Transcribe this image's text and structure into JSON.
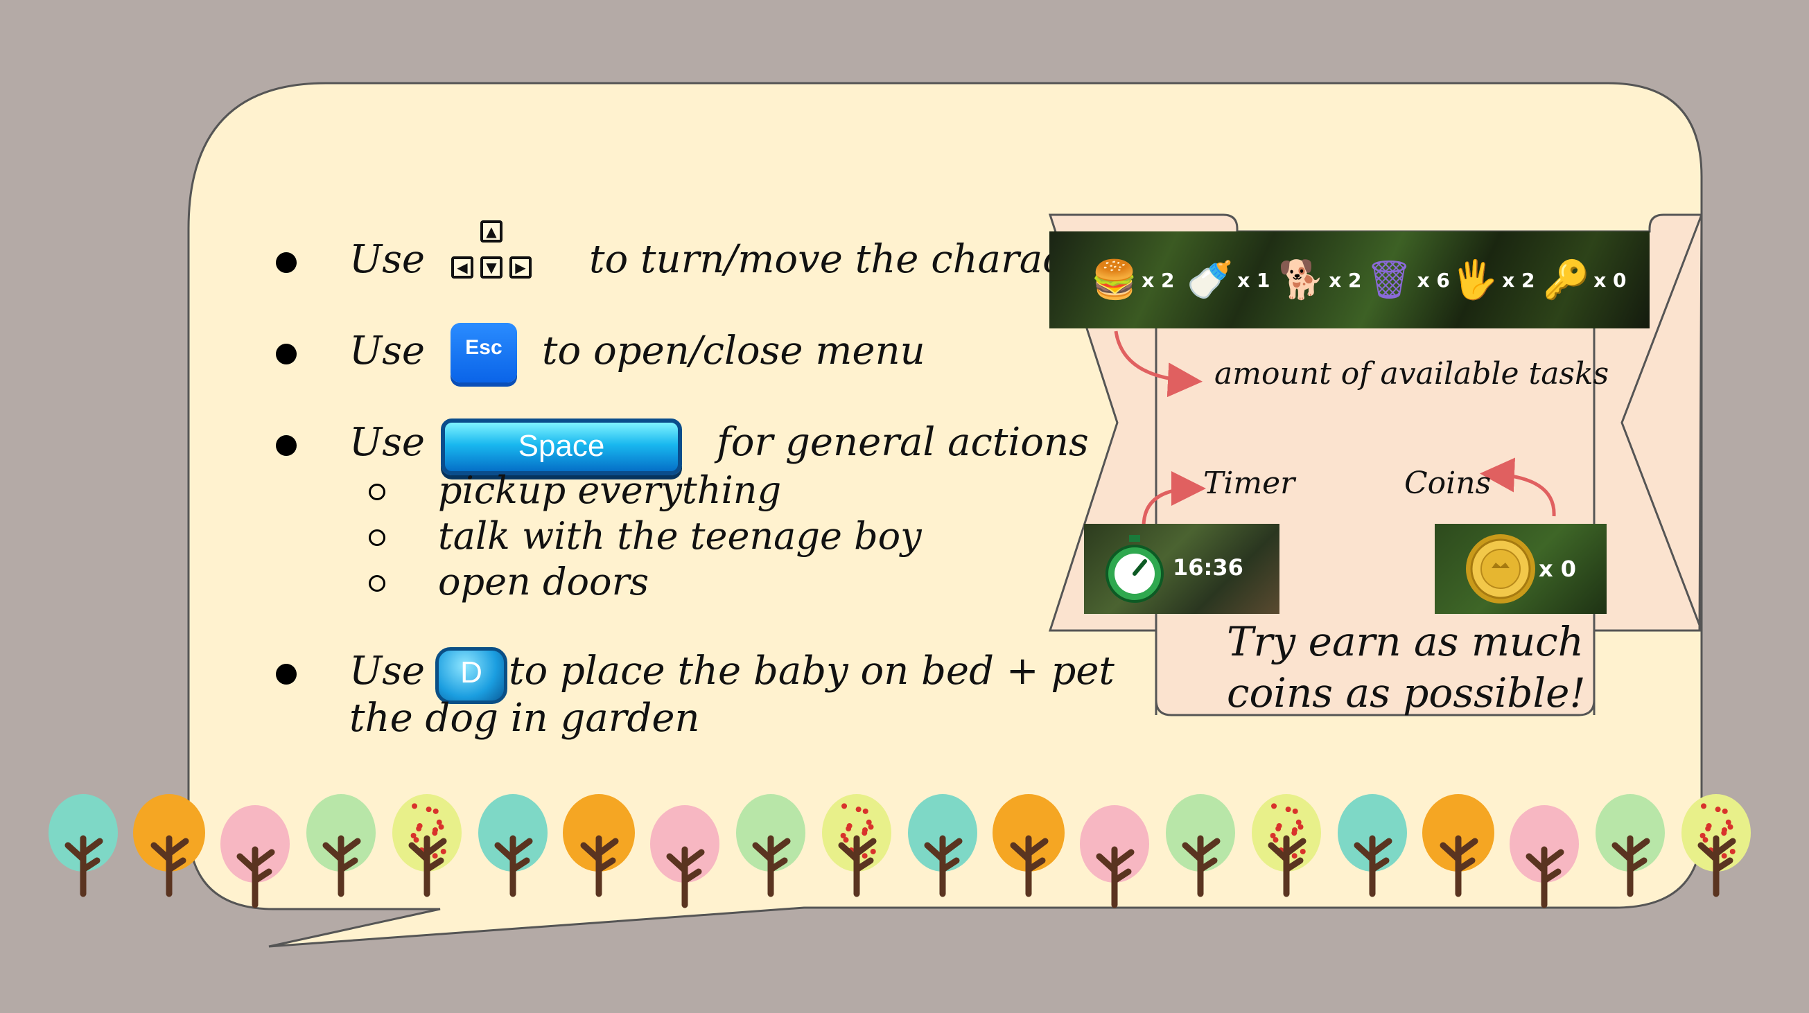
{
  "instructions": [
    {
      "use": "Use",
      "text": "to turn/move the character",
      "key": "arrow-keys"
    },
    {
      "use": "Use",
      "text": "to open/close menu",
      "key": "esc-key"
    },
    {
      "use": "Use",
      "text": "for general actions",
      "key": "space-key",
      "sub": [
        "pickup everything",
        "talk with the teenage boy",
        "open doors"
      ]
    },
    {
      "use": "Use",
      "text": "to place the baby on bed + pet",
      "text2": "the dog in garden",
      "key": "d-key"
    }
  ],
  "keys": {
    "esc": "Esc",
    "space": "Space",
    "d": "D",
    "arrows": [
      "▲",
      "◀",
      "▼",
      "▶"
    ]
  },
  "tasks": [
    {
      "icon": "burger-icon",
      "glyph": "🍔",
      "count": "x 2"
    },
    {
      "icon": "baby-bottle-icon",
      "glyph": "🍼",
      "count": "x 1"
    },
    {
      "icon": "dog-icon",
      "glyph": "🐕",
      "count": "x 2"
    },
    {
      "icon": "trash-can-icon",
      "glyph": "🗑",
      "count": "x 6"
    },
    {
      "icon": "hand-wash-icon",
      "glyph": "🖐",
      "count": "x 2"
    },
    {
      "icon": "keys-icon",
      "glyph": "🔑",
      "count": "x 0"
    }
  ],
  "panel": {
    "tasks_label": "amount of available tasks",
    "timer_label": "Timer",
    "coins_label": "Coins",
    "timer_value": "16:36",
    "coin_count": "x 0",
    "footer_line1": "Try earn as much",
    "footer_line2": "coins as possible!"
  },
  "colors": {
    "background": "#b4aaa6",
    "bubble": "#fff2cf",
    "panel": "#fbe3cf",
    "arrow": "#e06060"
  },
  "trees": [
    "teal",
    "orange",
    "pink",
    "lightgreen",
    "apple",
    "teal",
    "orange",
    "pink",
    "lightgreen",
    "apple",
    "teal",
    "orange",
    "pink",
    "lightgreen",
    "apple",
    "teal",
    "orange",
    "pink",
    "lightgreen",
    "apple"
  ]
}
